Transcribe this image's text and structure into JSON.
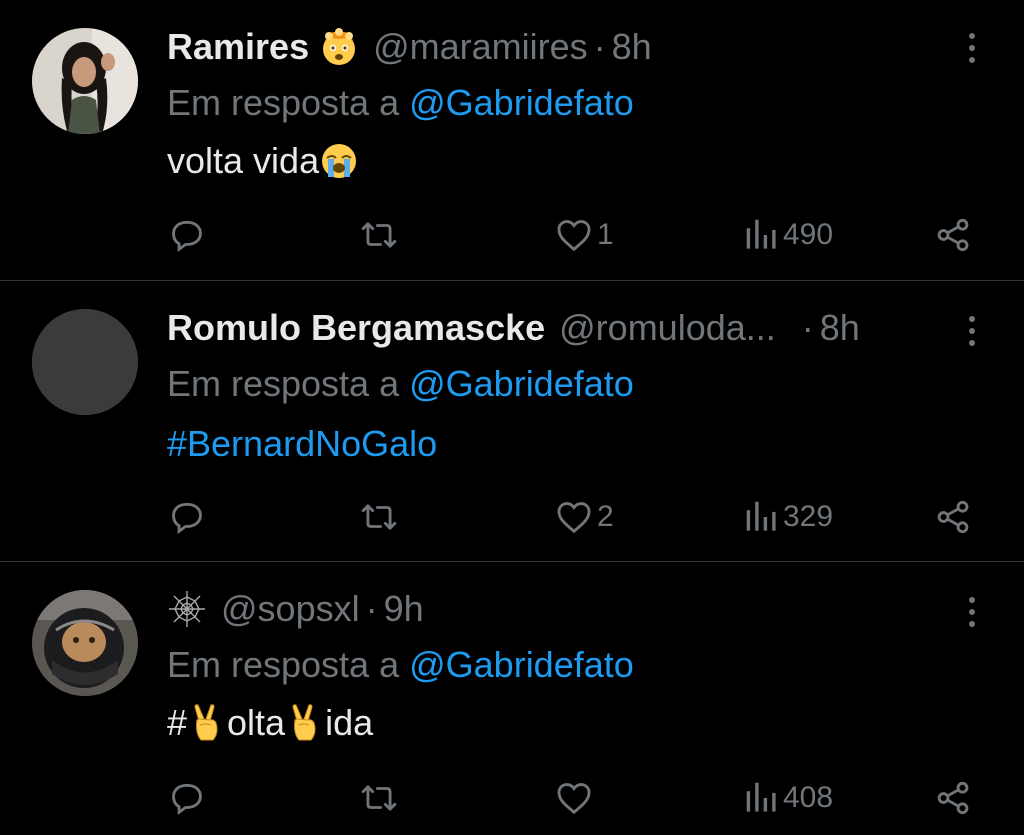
{
  "tweets": [
    {
      "display_name": "Ramires",
      "name_emoji": "exploding-head-emoji",
      "handle": "@maramiires",
      "separator": "·",
      "time": "8h",
      "reply_prefix": "Em resposta a ",
      "reply_to": "@Gabridefato",
      "text": "volta vida",
      "text_emoji": "loudly-crying-face-emoji",
      "likes": "1",
      "views": "490",
      "avatar": "avatar-photo-woman"
    },
    {
      "display_name": "Romulo Bergamascke",
      "handle": "@romuloda...",
      "separator": "·",
      "time": "8h",
      "reply_prefix": "Em resposta a ",
      "reply_to": "@Gabridefato",
      "text": "#BernardNoGalo",
      "likes": "2",
      "views": "329",
      "avatar": "avatar-placeholder"
    },
    {
      "name_emoji": "spider-web-emoji",
      "handle": "@sopsxl",
      "separator": "·",
      "time": "9h",
      "reply_prefix": "Em resposta a ",
      "reply_to": "@Gabridefato",
      "text_parts": [
        "#",
        "olta",
        "ida"
      ],
      "text_emoji": "victory-hand-emoji",
      "likes": "",
      "views": "408",
      "avatar": "avatar-photo-helmet-cat"
    }
  ],
  "colors": {
    "background": "#000000",
    "primary_text": "#e7e9ea",
    "secondary_text": "#71767b",
    "accent": "#1d9bf0",
    "divider": "#2f3336"
  },
  "icons": [
    "reply-icon",
    "retweet-icon",
    "like-icon",
    "views-icon",
    "share-icon",
    "more-icon"
  ]
}
